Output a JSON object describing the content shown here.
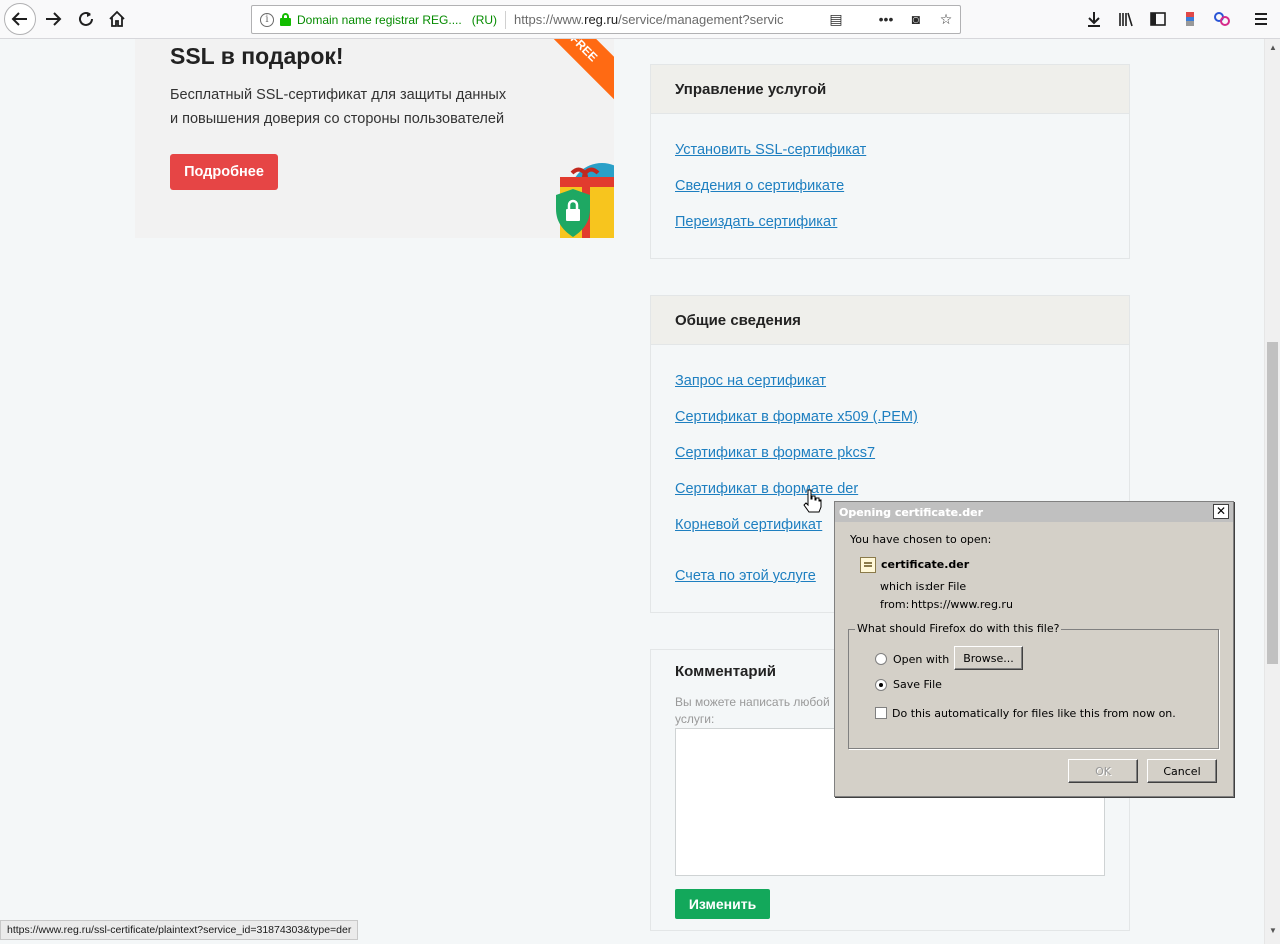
{
  "browser": {
    "identity": "Domain name registrar REG....",
    "country": "(RU)",
    "url_prefix": "https://www.",
    "url_host": "reg.ru",
    "url_path": "/service/management?servic"
  },
  "promo": {
    "title": "SSL в подарок!",
    "text_line1": "Бесплатный SSL-сертификат для защиты данных",
    "text_line2": "и повышения доверия со стороны пользователей",
    "button": "Подробнее",
    "ribbon": "FREE"
  },
  "service_panel": {
    "title": "Управление услугой",
    "links": [
      "Установить SSL-сертификат",
      "Сведения о сертификате",
      "Переиздать сертификат"
    ]
  },
  "info_panel": {
    "title": "Общие сведения",
    "links": [
      "Запрос на сертификат",
      "Сертификат в формате x509 (.PEM)",
      "Сертификат в формате pkcs7",
      "Сертификат в формате der",
      "Корневой сертификат"
    ],
    "invoices_link": "Счета по этой услуге"
  },
  "comment": {
    "title": "Комментарий",
    "hint_line1": "Вы можете написать любой",
    "hint_line2": "услуги:",
    "button": "Изменить"
  },
  "status_url": "https://www.reg.ru/ssl-certificate/plaintext?service_id=31874303&type=der",
  "dialog": {
    "title": "Opening certificate.der",
    "chosen": "You have chosen to open:",
    "filename": "certificate.der",
    "which_label": "which is:",
    "which_value": "der File",
    "from_label": "from:",
    "from_value": "https://www.reg.ru",
    "question": "What should Firefox do with this file?",
    "open_with": "Open with",
    "browse": "Browse...",
    "save_file": "Save File",
    "selected_option": "Save File",
    "auto_label": "Do this automatically for files like this from now on.",
    "ok": "OK",
    "cancel": "Cancel"
  }
}
